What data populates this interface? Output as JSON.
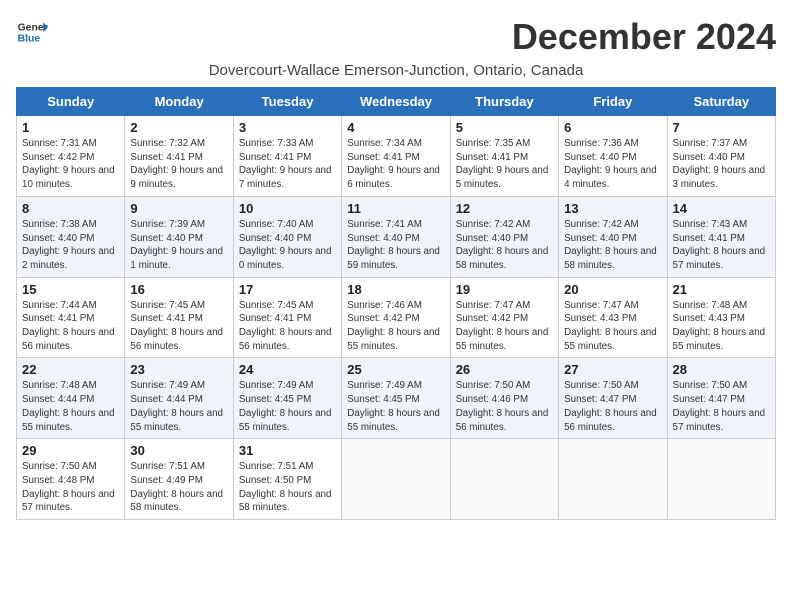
{
  "header": {
    "logo_line1": "General",
    "logo_line2": "Blue",
    "month_title": "December 2024",
    "subtitle": "Dovercourt-Wallace Emerson-Junction, Ontario, Canada"
  },
  "weekdays": [
    "Sunday",
    "Monday",
    "Tuesday",
    "Wednesday",
    "Thursday",
    "Friday",
    "Saturday"
  ],
  "weeks": [
    [
      {
        "day": "1",
        "sunrise": "7:31 AM",
        "sunset": "4:42 PM",
        "daylight": "9 hours and 10 minutes."
      },
      {
        "day": "2",
        "sunrise": "7:32 AM",
        "sunset": "4:41 PM",
        "daylight": "9 hours and 9 minutes."
      },
      {
        "day": "3",
        "sunrise": "7:33 AM",
        "sunset": "4:41 PM",
        "daylight": "9 hours and 7 minutes."
      },
      {
        "day": "4",
        "sunrise": "7:34 AM",
        "sunset": "4:41 PM",
        "daylight": "9 hours and 6 minutes."
      },
      {
        "day": "5",
        "sunrise": "7:35 AM",
        "sunset": "4:41 PM",
        "daylight": "9 hours and 5 minutes."
      },
      {
        "day": "6",
        "sunrise": "7:36 AM",
        "sunset": "4:40 PM",
        "daylight": "9 hours and 4 minutes."
      },
      {
        "day": "7",
        "sunrise": "7:37 AM",
        "sunset": "4:40 PM",
        "daylight": "9 hours and 3 minutes."
      }
    ],
    [
      {
        "day": "8",
        "sunrise": "7:38 AM",
        "sunset": "4:40 PM",
        "daylight": "9 hours and 2 minutes."
      },
      {
        "day": "9",
        "sunrise": "7:39 AM",
        "sunset": "4:40 PM",
        "daylight": "9 hours and 1 minute."
      },
      {
        "day": "10",
        "sunrise": "7:40 AM",
        "sunset": "4:40 PM",
        "daylight": "9 hours and 0 minutes."
      },
      {
        "day": "11",
        "sunrise": "7:41 AM",
        "sunset": "4:40 PM",
        "daylight": "8 hours and 59 minutes."
      },
      {
        "day": "12",
        "sunrise": "7:42 AM",
        "sunset": "4:40 PM",
        "daylight": "8 hours and 58 minutes."
      },
      {
        "day": "13",
        "sunrise": "7:42 AM",
        "sunset": "4:40 PM",
        "daylight": "8 hours and 58 minutes."
      },
      {
        "day": "14",
        "sunrise": "7:43 AM",
        "sunset": "4:41 PM",
        "daylight": "8 hours and 57 minutes."
      }
    ],
    [
      {
        "day": "15",
        "sunrise": "7:44 AM",
        "sunset": "4:41 PM",
        "daylight": "8 hours and 56 minutes."
      },
      {
        "day": "16",
        "sunrise": "7:45 AM",
        "sunset": "4:41 PM",
        "daylight": "8 hours and 56 minutes."
      },
      {
        "day": "17",
        "sunrise": "7:45 AM",
        "sunset": "4:41 PM",
        "daylight": "8 hours and 56 minutes."
      },
      {
        "day": "18",
        "sunrise": "7:46 AM",
        "sunset": "4:42 PM",
        "daylight": "8 hours and 55 minutes."
      },
      {
        "day": "19",
        "sunrise": "7:47 AM",
        "sunset": "4:42 PM",
        "daylight": "8 hours and 55 minutes."
      },
      {
        "day": "20",
        "sunrise": "7:47 AM",
        "sunset": "4:43 PM",
        "daylight": "8 hours and 55 minutes."
      },
      {
        "day": "21",
        "sunrise": "7:48 AM",
        "sunset": "4:43 PM",
        "daylight": "8 hours and 55 minutes."
      }
    ],
    [
      {
        "day": "22",
        "sunrise": "7:48 AM",
        "sunset": "4:44 PM",
        "daylight": "8 hours and 55 minutes."
      },
      {
        "day": "23",
        "sunrise": "7:49 AM",
        "sunset": "4:44 PM",
        "daylight": "8 hours and 55 minutes."
      },
      {
        "day": "24",
        "sunrise": "7:49 AM",
        "sunset": "4:45 PM",
        "daylight": "8 hours and 55 minutes."
      },
      {
        "day": "25",
        "sunrise": "7:49 AM",
        "sunset": "4:45 PM",
        "daylight": "8 hours and 55 minutes."
      },
      {
        "day": "26",
        "sunrise": "7:50 AM",
        "sunset": "4:46 PM",
        "daylight": "8 hours and 56 minutes."
      },
      {
        "day": "27",
        "sunrise": "7:50 AM",
        "sunset": "4:47 PM",
        "daylight": "8 hours and 56 minutes."
      },
      {
        "day": "28",
        "sunrise": "7:50 AM",
        "sunset": "4:47 PM",
        "daylight": "8 hours and 57 minutes."
      }
    ],
    [
      {
        "day": "29",
        "sunrise": "7:50 AM",
        "sunset": "4:48 PM",
        "daylight": "8 hours and 57 minutes."
      },
      {
        "day": "30",
        "sunrise": "7:51 AM",
        "sunset": "4:49 PM",
        "daylight": "8 hours and 58 minutes."
      },
      {
        "day": "31",
        "sunrise": "7:51 AM",
        "sunset": "4:50 PM",
        "daylight": "8 hours and 58 minutes."
      },
      null,
      null,
      null,
      null
    ]
  ]
}
